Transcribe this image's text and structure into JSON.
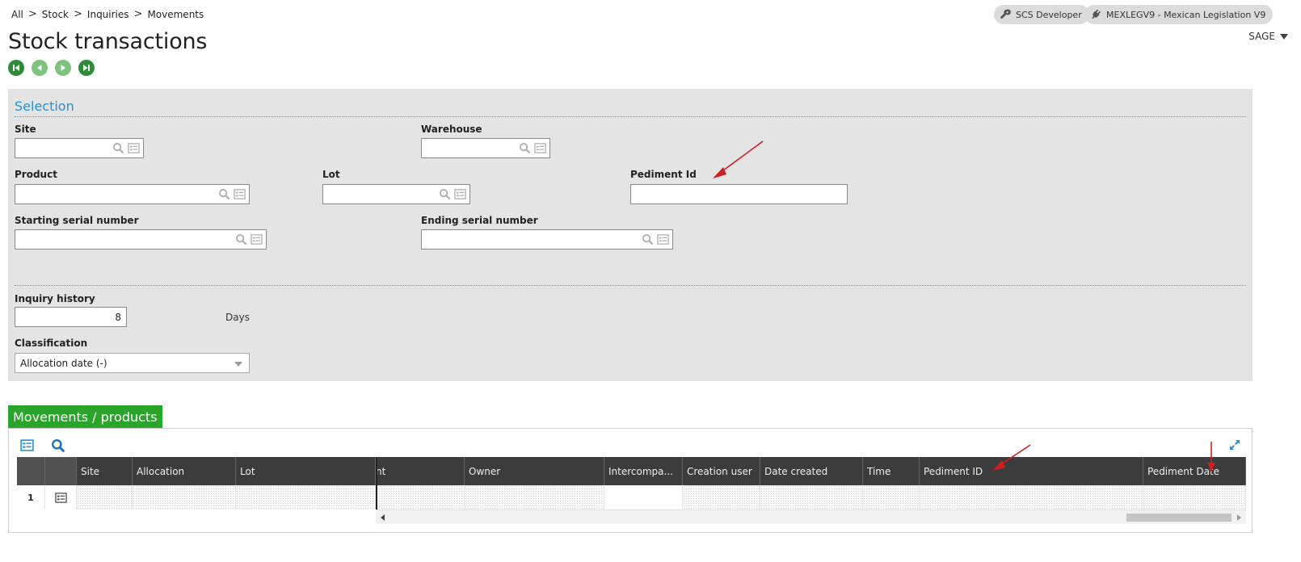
{
  "breadcrumb": {
    "items": [
      "All",
      "Stock",
      "Inquiries",
      "Movements"
    ],
    "separator": ">"
  },
  "header": {
    "user_chip": "SCS Developer",
    "folder_chip": "MEXLEGV9 - Mexican Legislation V9",
    "user_menu": "SAGE"
  },
  "page": {
    "title": "Stock transactions"
  },
  "navigation": {
    "buttons": [
      "first-record-icon",
      "previous-record-icon",
      "next-record-icon",
      "last-record-icon"
    ]
  },
  "selection": {
    "title": "Selection",
    "site": {
      "label": "Site",
      "value": ""
    },
    "warehouse": {
      "label": "Warehouse",
      "value": ""
    },
    "product": {
      "label": "Product",
      "value": ""
    },
    "lot": {
      "label": "Lot",
      "value": ""
    },
    "pediment_id": {
      "label": "Pediment Id",
      "value": ""
    },
    "starting_serial": {
      "label": "Starting serial number",
      "value": ""
    },
    "ending_serial": {
      "label": "Ending serial number",
      "value": ""
    },
    "inquiry_history": {
      "label": "Inquiry history",
      "value": "8",
      "unit": "Days"
    },
    "classification": {
      "label": "Classification",
      "value": "Allocation date (-)"
    }
  },
  "movements": {
    "tab_label": "Movements / products",
    "columns": [
      "",
      "",
      "Site",
      "Allocation",
      "Lot",
      "nt",
      "Owner",
      "Intercompa...",
      "Creation user",
      "Date created",
      "Time",
      "Pediment ID",
      "Pediment Date"
    ],
    "rows": [
      {
        "num": "1"
      }
    ]
  },
  "colors": {
    "accent_blue": "#2a8fd0",
    "tab_green": "#2aa42a",
    "nav_green": "#2e8b3a",
    "annotation_red": "#cc1f1f"
  }
}
